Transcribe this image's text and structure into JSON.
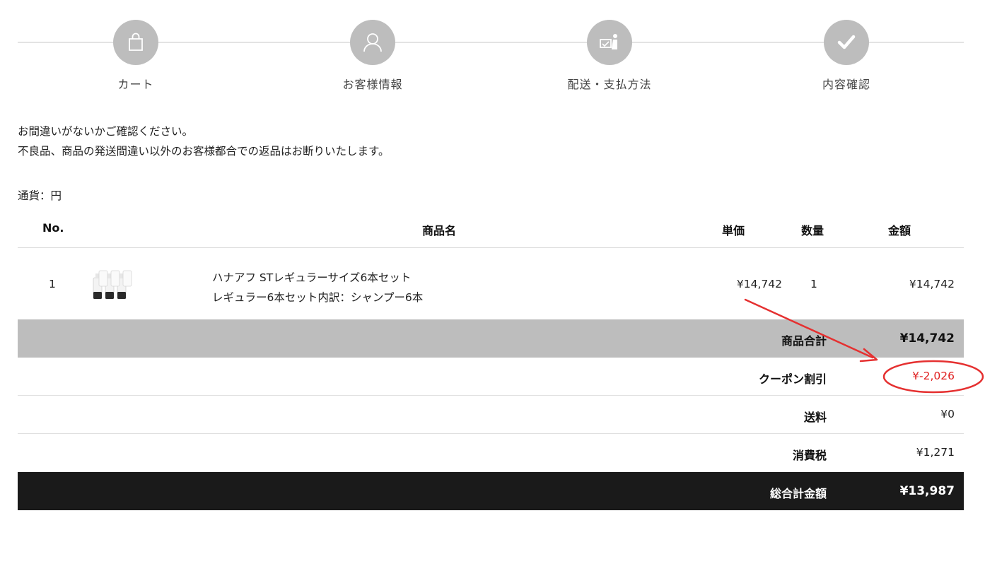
{
  "steps": [
    {
      "label": "カート",
      "icon": "shopping-bag-icon",
      "active": false
    },
    {
      "label": "お客様情報",
      "icon": "user-icon",
      "active": false
    },
    {
      "label": "配送・支払方法",
      "icon": "delivery-payment-icon",
      "active": false
    },
    {
      "label": "内容確認",
      "icon": "checkmark-icon",
      "active": true
    }
  ],
  "notes": {
    "line1": "お間違いがないかご確認ください。",
    "line2": "不良品、商品の発送間違い以外のお客様都合での返品はお断りいたします。"
  },
  "currency": "通貨：円",
  "table": {
    "headers": {
      "no": "No.",
      "name": "商品名",
      "unit_price": "単価",
      "qty": "数量",
      "amount": "金額"
    },
    "rows": [
      {
        "no": "1",
        "image": "shampoo-bottles-image",
        "name_line1": "ハナアフ STレギュラーサイズ6本セット",
        "name_line2": "レギュラー6本セット内訳：シャンプー6本",
        "unit_price": "¥14,742",
        "qty": "1",
        "amount": "¥14,742"
      }
    ]
  },
  "summary": {
    "subtotal_label": "商品合計",
    "subtotal_value": "¥14,742",
    "coupon_label": "クーポン割引",
    "coupon_value": "¥-2,026",
    "shipping_label": "送料",
    "shipping_value": "¥0",
    "tax_label": "消費税",
    "tax_value": "¥1,271",
    "total_label": "総合計金額",
    "total_value": "¥13,987"
  },
  "colors": {
    "step_inactive": "#bdbdbd",
    "step_active": "#1a1a1a",
    "subtotal_bg": "#bdbdbd",
    "total_bg": "#1a1a1a",
    "discount_red": "#e02020",
    "annotation_red": "#e53030"
  }
}
